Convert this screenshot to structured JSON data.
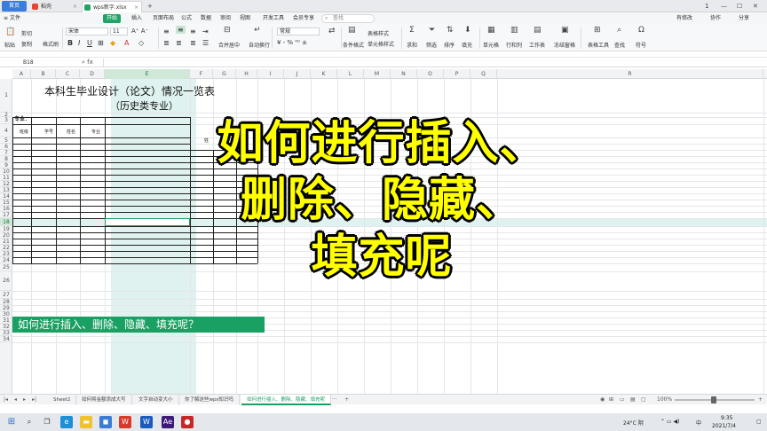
{
  "titlebar": {
    "tabs": [
      {
        "label": "首页"
      },
      {
        "label": "稻壳"
      },
      {
        "label": "wps新字.xlsx"
      }
    ],
    "close_glyph": "×",
    "add_glyph": "+",
    "window_controls": [
      "1",
      "—",
      "☐",
      "✕"
    ]
  },
  "menubar": {
    "file_label": "文件",
    "items": [
      "开始",
      "插入",
      "页面布局",
      "公式",
      "数据",
      "审阅",
      "视图",
      "开发工具",
      "会员专享"
    ],
    "active_index": 0,
    "search_placeholder": "查找",
    "right_items": [
      "有修改",
      "协作",
      "分享"
    ]
  },
  "ribbon": {
    "paste": "粘贴",
    "cut": "剪切",
    "copy": "复制",
    "format_painter": "格式刷",
    "font_name": "宋体",
    "font_size": "11",
    "merge_center": "合并居中",
    "auto_wrap": "自动换行",
    "number_format": "常规",
    "conditional_format": "条件格式",
    "table_style": "表格样式",
    "cell_style": "单元格样式",
    "sum": "求和",
    "filter": "筛选",
    "sort": "排序",
    "fill": "填充",
    "cell": "单元格",
    "row_col": "行和列",
    "worksheet": "工作表",
    "freeze_pane": "冻结窗格",
    "table_tools": "表格工具",
    "find": "查找",
    "symbol": "符号"
  },
  "formulabar": {
    "cell_ref": "B18",
    "fx": "fx"
  },
  "grid": {
    "columns": [
      "A",
      "B",
      "C",
      "D",
      "E",
      "F",
      "G",
      "H",
      "I",
      "J",
      "K",
      "L",
      "M",
      "N",
      "O",
      "P",
      "Q",
      "R"
    ],
    "selected_column": "E",
    "rows": [
      "1",
      "2",
      "3",
      "4",
      "5",
      "6",
      "7",
      "8",
      "9",
      "10",
      "11",
      "12",
      "13",
      "14",
      "15",
      "16",
      "17",
      "18",
      "19",
      "20",
      "21",
      "22",
      "23",
      "24",
      "25",
      "26",
      "27",
      "28",
      "29",
      "30",
      "31",
      "32",
      "33",
      "34"
    ],
    "selected_row": "18",
    "title": "本科生毕业设计（论文）情况一览表",
    "subtitle": "（历史类专业）",
    "major_label": "专业：",
    "headers": [
      "班级",
      "学号",
      "姓名",
      "专业"
    ],
    "header_truncated": "姓",
    "banner": "如何进行插入、删除、隐藏、填充呢？"
  },
  "overlay": {
    "lines": [
      "如何进行插入、",
      "删除、隐藏、",
      "填充呢"
    ]
  },
  "sheettabs": {
    "tabs": [
      "Sheet2",
      "如何将金额添成大写",
      "文字自动变大小",
      "你了解这些wps知识吗",
      "如何进行插入、删除、隐藏、填充呢"
    ],
    "active_index": 4,
    "more_glyph": "···",
    "add_glyph": "+",
    "zoom_label": "100%"
  },
  "taskbar": {
    "weather": "24°C 阴",
    "ime": "中",
    "time": "9:35",
    "date": "2021/7/4"
  }
}
